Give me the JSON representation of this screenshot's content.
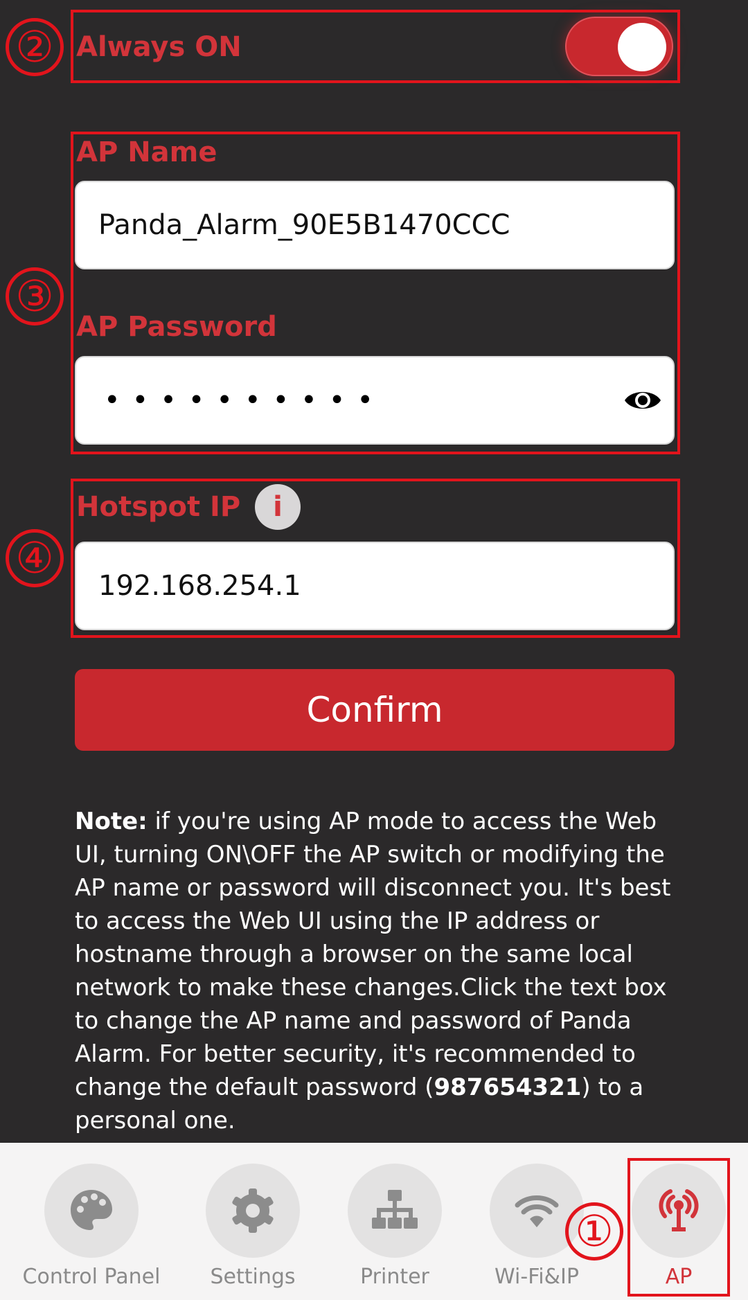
{
  "ap_settings": {
    "always_on_label": "Always ON",
    "always_on": true,
    "ap_name_label": "AP Name",
    "ap_name_value": "Panda_Alarm_90E5B1470CCC",
    "ap_password_label": "AP Password",
    "ap_password_mask": "••••••••••",
    "hotspot_ip_label": "Hotspot IP",
    "hotspot_ip_info": "i",
    "hotspot_ip_value": "192.168.254.1",
    "confirm_label": "Confirm"
  },
  "note": {
    "bold_prefix": "Note:",
    "text_part1": " if you're using AP mode to access the Web UI, turning ON\\OFF the AP switch or modifying the AP name or password will disconnect you. It's best to access the Web UI using the IP address or hostname through a browser on the same local network to make these changes.Click the text box to change the AP name and password of Panda Alarm. For better security, it's recommended to change the default password (",
    "default_password": "987654321",
    "text_part2": ") to a personal one."
  },
  "annotations": [
    "①",
    "②",
    "③",
    "④"
  ],
  "tabs": [
    {
      "label": "Control Panel",
      "icon": "palette-icon",
      "active": false
    },
    {
      "label": "Settings",
      "icon": "gear-icon",
      "active": false
    },
    {
      "label": "Printer",
      "icon": "network-tree-icon",
      "active": false
    },
    {
      "label": "Wi-Fi&IP",
      "icon": "wifi-icon",
      "active": false
    },
    {
      "label": "AP",
      "icon": "broadcast-tower-icon",
      "active": true
    }
  ],
  "colors": {
    "background": "#2b292a",
    "accent": "#c8282e",
    "label_red": "#d2343a",
    "annotation_red": "#e2141c",
    "tab_inactive": "#8a8a8a",
    "tab_active": "#d2343a"
  }
}
